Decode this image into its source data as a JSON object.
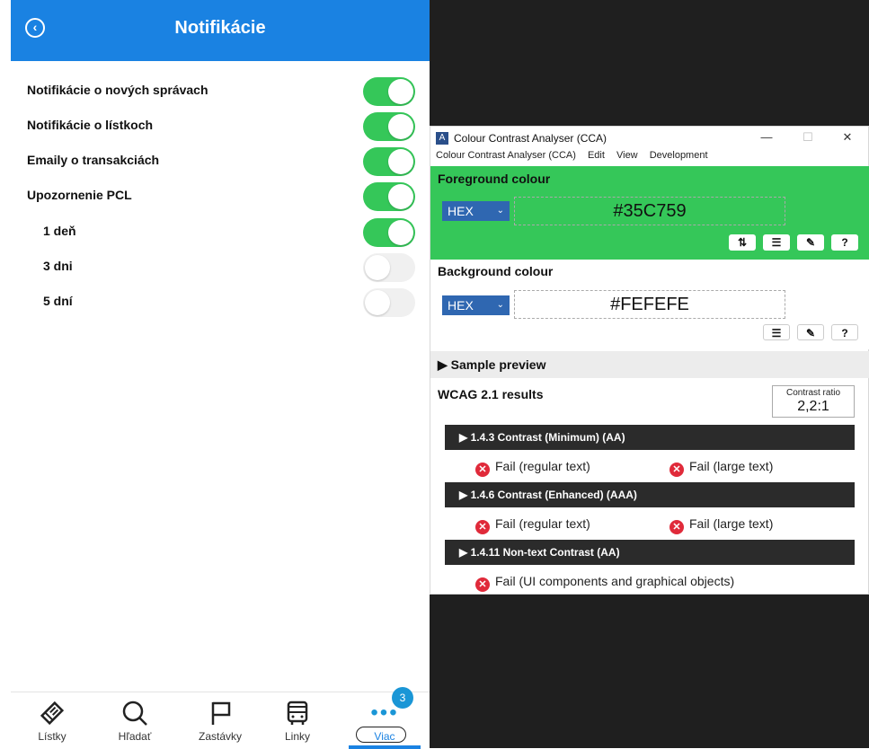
{
  "app": {
    "title": "Notifikácie",
    "back_icon": "‹"
  },
  "settings": [
    {
      "label": "Notifikácie o nových správach",
      "on": true
    },
    {
      "label": "Notifikácie o lístkoch",
      "on": true
    },
    {
      "label": "Emaily o transakciách",
      "on": true
    },
    {
      "label": "Upozornenie PCL",
      "on": true
    },
    {
      "label": "1 deň",
      "on": true
    },
    {
      "label": "3 dni",
      "on": false
    },
    {
      "label": "5 dní",
      "on": false
    }
  ],
  "nav": {
    "items": [
      {
        "label": "Lístky",
        "icon": "ticket-icon"
      },
      {
        "label": "Hľadať",
        "icon": "search-icon"
      },
      {
        "label": "Zastávky",
        "icon": "flag-icon"
      },
      {
        "label": "Linky",
        "icon": "bus-icon"
      },
      {
        "label": "Viac",
        "icon": "more-icon"
      }
    ],
    "badge": "3",
    "active": "Viac"
  },
  "cca": {
    "window_title": "Colour Contrast Analyser (CCA)",
    "menu": [
      "Colour Contrast Analyser (CCA)",
      "Edit",
      "View",
      "Development"
    ],
    "foreground": {
      "title": "Foreground colour",
      "format": "HEX",
      "value": "#35C759",
      "color": "#35C759"
    },
    "background": {
      "title": "Background colour",
      "format": "HEX",
      "value": "#FEFEFE",
      "color": "#FEFEFE"
    },
    "sample_label": "Sample preview",
    "wcag_title": "WCAG 2.1 results",
    "ratio_label": "Contrast ratio",
    "ratio_value": "2,2:1",
    "criteria": [
      {
        "label": "1.4.3 Contrast (Minimum) (AA)",
        "results": [
          "Fail (regular text)",
          "Fail (large text)"
        ]
      },
      {
        "label": "1.4.6 Contrast (Enhanced) (AAA)",
        "results": [
          "Fail (regular text)",
          "Fail (large text)"
        ]
      },
      {
        "label": "1.4.11 Non-text Contrast (AA)",
        "results": [
          "Fail (UI components and graphical objects)"
        ]
      }
    ]
  }
}
